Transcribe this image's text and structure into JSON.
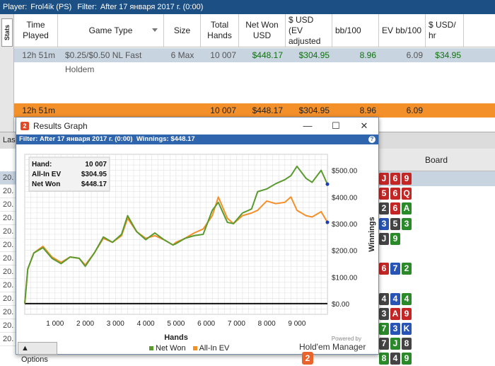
{
  "playerbar": {
    "player_label": "Player:",
    "player": "Frol4ik (PS)",
    "filter_label": "Filter:",
    "filter": "After 17 января 2017 г. (0:00)"
  },
  "statstab": {
    "label": "Stats"
  },
  "columns": {
    "time": "Time Played",
    "game": "Game Type",
    "size": "Size",
    "hands": "Total Hands",
    "net": "Net Won USD",
    "usd": "$ USD (EV adjusted",
    "bb": "bb/100",
    "ev": "EV bb/100",
    "usdhr": "$ USD/ hr"
  },
  "row1": {
    "time": "12h 51m",
    "game": "$0.25/$0.50 NL Fast Holdem",
    "size": "6 Max",
    "hands": "10 007",
    "net": "$448.17",
    "usd": "$304.95",
    "bb": "8.96",
    "ev": "6.09",
    "usdhr": "$34.95"
  },
  "total": {
    "time": "12h 51m",
    "hands": "10 007",
    "net": "$448.17",
    "usd": "$304.95",
    "bb": "8.96",
    "ev": "6.09"
  },
  "lower": {
    "board_header": "Board",
    "tab_label": "Las",
    "left_rows": [
      "20.",
      "20.",
      "20.",
      "20.",
      "20.",
      "20.",
      "20.",
      "20.",
      "20.",
      "20.",
      "20.",
      "20.",
      "20."
    ]
  },
  "window": {
    "title": "Results Graph",
    "minimize": "—",
    "maximize": "☐",
    "close": "✕",
    "filter_label": "Filter:",
    "filter_value": "After 17 января 2017 г. (0:00)",
    "winnings_label": "Winnings:",
    "winnings_value": "$448.17",
    "options_label": "Options",
    "legend_net": "Net Won",
    "legend_ev": "All-In EV",
    "powered": "Powered by",
    "brand": "Hold'em Manager"
  },
  "summary": {
    "hand_label": "Hand:",
    "hand": "10 007",
    "ev_label": "All-In EV",
    "ev": "$304.95",
    "net_label": "Net Won",
    "net": "$448.17"
  },
  "chart_data": {
    "type": "line",
    "xlabel": "Hands",
    "ylabel": "Winnings",
    "xlim": [
      0,
      10007
    ],
    "ylim": [
      -40,
      560
    ],
    "x_ticks": [
      "1 000",
      "2 000",
      "3 000",
      "4 000",
      "5 000",
      "6 000",
      "7 000",
      "8 000",
      "9 000"
    ],
    "y_ticks": [
      "$0.00",
      "$100.00",
      "$200.00",
      "$300.00",
      "$400.00",
      "$500.00"
    ],
    "colors": {
      "net": "#5a9a2e",
      "ev": "#f4902a",
      "grid": "#e2e2e2"
    },
    "series": [
      {
        "name": "Net Won",
        "x": [
          0,
          100,
          300,
          600,
          900,
          1200,
          1500,
          1800,
          2000,
          2300,
          2600,
          2900,
          3200,
          3400,
          3700,
          4000,
          4300,
          4600,
          4900,
          5000,
          5300,
          5600,
          5900,
          6200,
          6400,
          6700,
          6900,
          7200,
          7500,
          7700,
          8000,
          8300,
          8600,
          8800,
          9000,
          9300,
          9500,
          9800,
          10007
        ],
        "values": [
          0,
          130,
          190,
          210,
          170,
          150,
          175,
          170,
          140,
          190,
          250,
          230,
          260,
          330,
          270,
          240,
          265,
          240,
          220,
          225,
          245,
          255,
          260,
          350,
          380,
          305,
          300,
          340,
          355,
          420,
          430,
          450,
          465,
          480,
          515,
          470,
          455,
          500,
          448
        ]
      },
      {
        "name": "All-In EV",
        "x": [
          0,
          100,
          300,
          600,
          900,
          1200,
          1500,
          1800,
          2000,
          2300,
          2600,
          2900,
          3200,
          3400,
          3700,
          4000,
          4300,
          4600,
          4900,
          5000,
          5300,
          5600,
          5900,
          6200,
          6400,
          6700,
          6900,
          7200,
          7500,
          7700,
          8000,
          8300,
          8600,
          8800,
          9000,
          9300,
          9500,
          9800,
          10007
        ],
        "values": [
          0,
          130,
          190,
          215,
          175,
          155,
          175,
          170,
          145,
          190,
          245,
          230,
          255,
          320,
          270,
          245,
          255,
          240,
          220,
          230,
          245,
          265,
          280,
          330,
          400,
          320,
          300,
          330,
          340,
          350,
          385,
          375,
          380,
          400,
          350,
          330,
          325,
          345,
          305
        ]
      }
    ]
  },
  "boards": [
    [
      {
        "v": "J",
        "c": "r"
      },
      {
        "v": "6",
        "c": "r"
      },
      {
        "v": "9",
        "c": "r"
      }
    ],
    [
      {
        "v": "5",
        "c": "r"
      },
      {
        "v": "6",
        "c": "r"
      },
      {
        "v": "Q",
        "c": "r"
      }
    ],
    [
      {
        "v": "2",
        "c": "k"
      },
      {
        "v": "6",
        "c": "r"
      },
      {
        "v": "A",
        "c": "g"
      }
    ],
    [
      {
        "v": "3",
        "c": "b"
      },
      {
        "v": "5",
        "c": "k"
      },
      {
        "v": "3",
        "c": "g"
      }
    ],
    [
      {
        "v": "J",
        "c": "k"
      },
      {
        "v": "9",
        "c": "g"
      }
    ],
    [],
    [
      {
        "v": "6",
        "c": "r"
      },
      {
        "v": "7",
        "c": "b"
      },
      {
        "v": "2",
        "c": "g"
      }
    ],
    [],
    [
      {
        "v": "4",
        "c": "k"
      },
      {
        "v": "4",
        "c": "b"
      },
      {
        "v": "4",
        "c": "g"
      }
    ],
    [
      {
        "v": "3",
        "c": "k"
      },
      {
        "v": "A",
        "c": "r"
      },
      {
        "v": "9",
        "c": "r"
      }
    ],
    [
      {
        "v": "7",
        "c": "g"
      },
      {
        "v": "3",
        "c": "b"
      },
      {
        "v": "K",
        "c": "b"
      }
    ],
    [
      {
        "v": "7",
        "c": "k"
      },
      {
        "v": "J",
        "c": "g"
      },
      {
        "v": "8",
        "c": "k"
      }
    ],
    [
      {
        "v": "8",
        "c": "g"
      },
      {
        "v": "4",
        "c": "k"
      },
      {
        "v": "9",
        "c": "g"
      }
    ]
  ]
}
